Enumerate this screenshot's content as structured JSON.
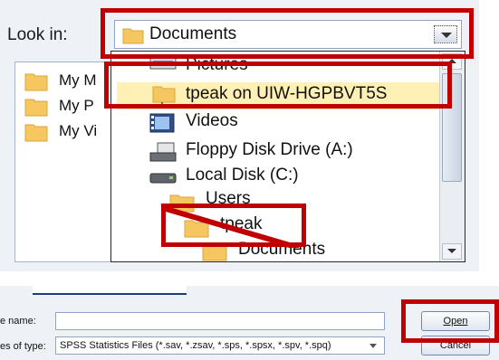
{
  "look_in": {
    "label": "Look in:",
    "selected": "Documents"
  },
  "file_list": [
    {
      "label": "My M"
    },
    {
      "label": "My P"
    },
    {
      "label": "My Vi"
    }
  ],
  "dropdown_items": [
    {
      "label": "Pictures",
      "icon": "pictures-icon"
    },
    {
      "label": "tpeak on UIW-HGPBVT5S",
      "icon": "network-folder-icon",
      "selected": true
    },
    {
      "label": "Videos",
      "icon": "videos-icon"
    },
    {
      "label": "Floppy Disk Drive (A:)",
      "icon": "floppy-drive-icon"
    },
    {
      "label": "Local Disk (C:)",
      "icon": "local-disk-icon"
    },
    {
      "label": "Users",
      "icon": "folder-icon"
    },
    {
      "label": "tpeak",
      "icon": "folder-icon"
    },
    {
      "label": "Documents",
      "icon": "folder-icon"
    }
  ],
  "bottom": {
    "file_name_label": "e name:",
    "file_name_value": "",
    "files_of_type_label": "es of type:",
    "files_of_type_value": "SPSS Statistics Files (*.sav, *.zsav, *.sps, *.spsx, *.spv, *.spq)",
    "open_label": "Open",
    "cancel_label": "Cancel"
  },
  "colors": {
    "highlight": "#c00000",
    "folder": "#f6c760",
    "selection": "#fff0b5"
  }
}
